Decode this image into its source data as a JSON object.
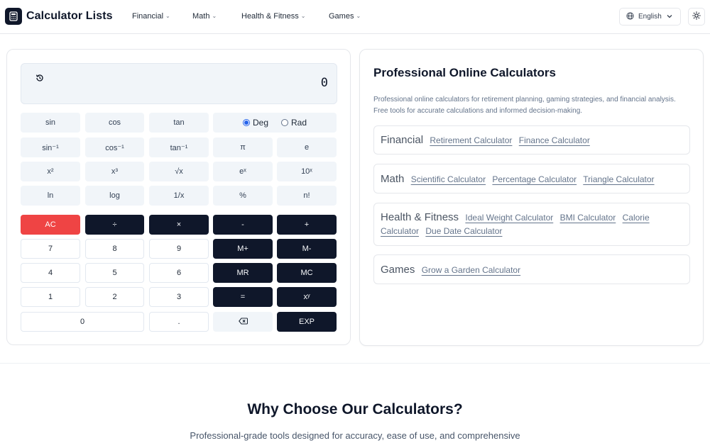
{
  "brand": {
    "name": "Calculator Lists"
  },
  "nav": {
    "items": [
      {
        "label": "Financial"
      },
      {
        "label": "Math"
      },
      {
        "label": "Health & Fitness"
      },
      {
        "label": "Games"
      }
    ]
  },
  "header": {
    "language": "English"
  },
  "calculator": {
    "display": "0",
    "angle_mode": {
      "deg": "Deg",
      "rad": "Rad",
      "selected": "Deg"
    },
    "rows": [
      [
        "sin",
        "cos",
        "tan"
      ],
      [
        "sin⁻¹",
        "cos⁻¹",
        "tan⁻¹",
        "π",
        "e"
      ],
      [
        "x²",
        "x³",
        "√x",
        "eˣ",
        "10ˣ"
      ],
      [
        "ln",
        "log",
        "1/x",
        "%",
        "n!"
      ],
      [
        "AC",
        "÷",
        "×",
        "-",
        "+"
      ],
      [
        "7",
        "8",
        "9",
        "M+",
        "M-"
      ],
      [
        "4",
        "5",
        "6",
        "MR",
        "MC"
      ],
      [
        "1",
        "2",
        "3",
        "=",
        "xʸ"
      ],
      [
        "0",
        ".",
        "⌫",
        "EXP"
      ]
    ]
  },
  "info": {
    "title": "Professional Online Calculators",
    "description": "Professional online calculators for retirement planning, gaming strategies, and financial analysis. Free tools for accurate calculations and informed decision-making.",
    "categories": [
      {
        "name": "Financial",
        "links": [
          "Retirement Calculator",
          "Finance Calculator"
        ]
      },
      {
        "name": "Math",
        "links": [
          "Scientific Calculator",
          "Percentage Calculator",
          "Triangle Calculator"
        ]
      },
      {
        "name": "Health & Fitness",
        "links": [
          "Ideal Weight Calculator",
          "BMI Calculator",
          "Calorie Calculator",
          "Due Date Calculator"
        ]
      },
      {
        "name": "Games",
        "links": [
          "Grow a Garden Calculator"
        ]
      }
    ]
  },
  "why": {
    "title": "Why Choose Our Calculators?",
    "subtitle": "Professional-grade tools designed for accuracy, ease of use, and comprehensive"
  }
}
